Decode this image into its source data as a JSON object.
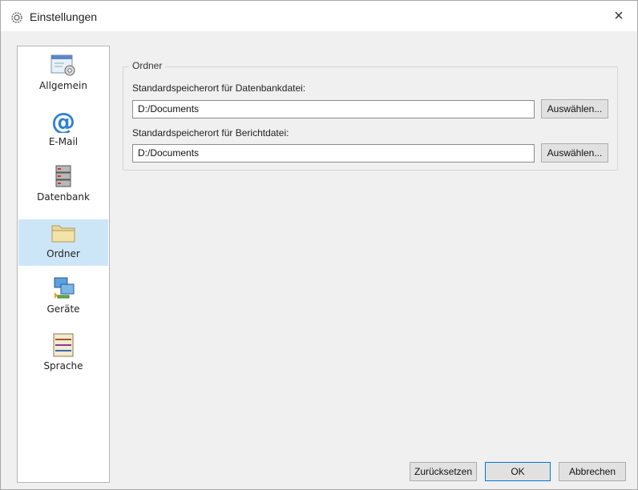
{
  "window": {
    "title": "Einstellungen",
    "icon": "gear-icon",
    "close_glyph": "×"
  },
  "sidebar": {
    "items": [
      {
        "label": "Allgemein",
        "icon": "general-settings-icon",
        "selected": false
      },
      {
        "label": "E-Mail",
        "icon": "at-sign-icon",
        "selected": false
      },
      {
        "label": "Datenbank",
        "icon": "database-icon",
        "selected": false
      },
      {
        "label": "Ordner",
        "icon": "folder-icon",
        "selected": true
      },
      {
        "label": "Geräte",
        "icon": "devices-icon",
        "selected": false
      },
      {
        "label": "Sprache",
        "icon": "language-icon",
        "selected": false
      }
    ]
  },
  "folders": {
    "group_title": "Ordner",
    "db_label": "Standardspeicherort für Datenbankdatei:",
    "db_value": "D:/Documents",
    "report_label": "Standardspeicherort für Berichtdatei:",
    "report_value": "D:/Documents",
    "pick_label": "Auswählen..."
  },
  "footer": {
    "reset_label": "Zurücksetzen",
    "ok_label": "OK",
    "cancel_label": "Abbrechen"
  },
  "colors": {
    "selection": "#cde6f7",
    "window_bg": "#f0f0f0",
    "default_button_border": "#0078d7"
  }
}
